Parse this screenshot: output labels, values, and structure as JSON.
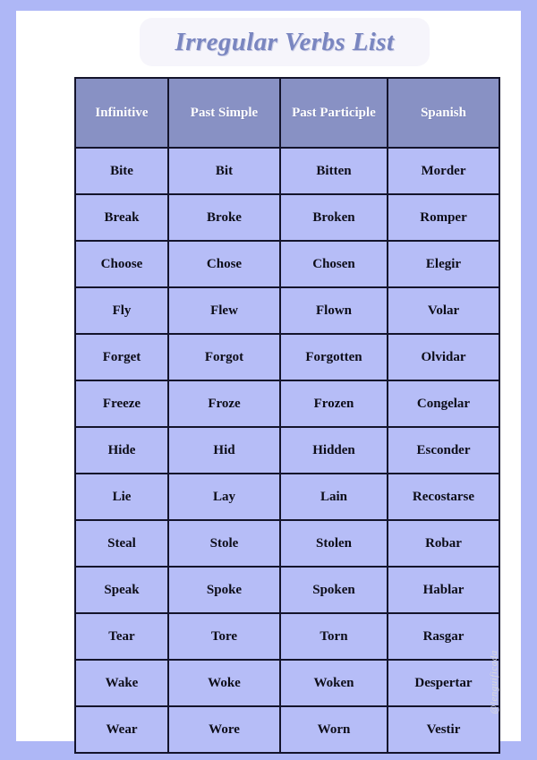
{
  "page": {
    "title": "Irregular Verbs List",
    "frame_color": "#aeb7f6",
    "page_color": "#ffffff",
    "title_color": "#7a86c0",
    "header_bg": "#8891c4",
    "cell_bg": "#b6bdf7",
    "border_color": "#14142b"
  },
  "table": {
    "columns": [
      "Infinitive",
      "Past Simple",
      "Past Participle",
      "Spanish"
    ],
    "rows": [
      {
        "infinitive": "Bite",
        "past_simple": "Bit",
        "past_participle": "Bitten",
        "spanish": "Morder"
      },
      {
        "infinitive": "Break",
        "past_simple": "Broke",
        "past_participle": "Broken",
        "spanish": "Romper"
      },
      {
        "infinitive": "Choose",
        "past_simple": "Chose",
        "past_participle": "Chosen",
        "spanish": "Elegir"
      },
      {
        "infinitive": "Fly",
        "past_simple": "Flew",
        "past_participle": "Flown",
        "spanish": "Volar"
      },
      {
        "infinitive": "Forget",
        "past_simple": "Forgot",
        "past_participle": "Forgotten",
        "spanish": "Olvidar"
      },
      {
        "infinitive": "Freeze",
        "past_simple": "Froze",
        "past_participle": "Frozen",
        "spanish": "Congelar"
      },
      {
        "infinitive": "Hide",
        "past_simple": "Hid",
        "past_participle": "Hidden",
        "spanish": "Esconder"
      },
      {
        "infinitive": "Lie",
        "past_simple": "Lay",
        "past_participle": "Lain",
        "spanish": "Recostarse"
      },
      {
        "infinitive": "Steal",
        "past_simple": "Stole",
        "past_participle": "Stolen",
        "spanish": "Robar"
      },
      {
        "infinitive": "Speak",
        "past_simple": "Spoke",
        "past_participle": "Spoken",
        "spanish": "Hablar"
      },
      {
        "infinitive": "Tear",
        "past_simple": "Tore",
        "past_participle": "Torn",
        "spanish": "Rasgar"
      },
      {
        "infinitive": "Wake",
        "past_simple": "Woke",
        "past_participle": "Woken",
        "spanish": "Despertar"
      },
      {
        "infinitive": "Wear",
        "past_simple": "Wore",
        "past_participle": "Worn",
        "spanish": "Vestir"
      }
    ]
  },
  "watermark": {
    "handle": "@lenguificada"
  }
}
